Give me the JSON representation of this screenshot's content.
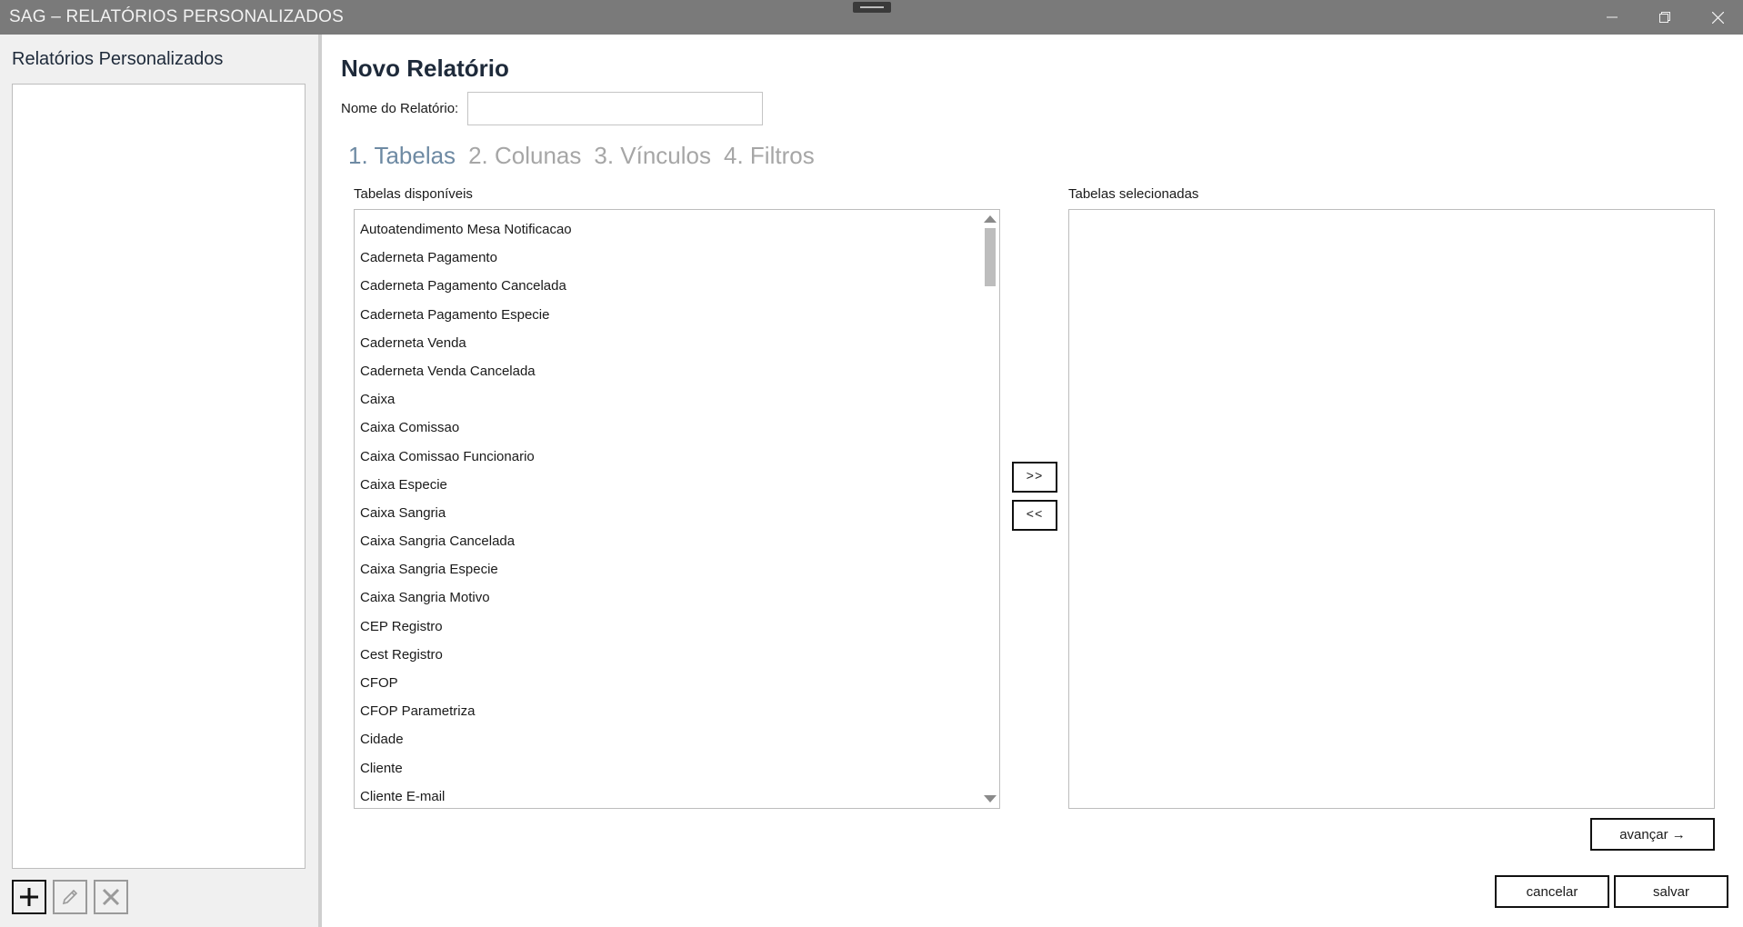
{
  "window": {
    "title": "SAG – RELATÓRIOS PERSONALIZADOS",
    "controls": [
      "minimize-icon",
      "restore-icon",
      "close-icon"
    ]
  },
  "sidebar": {
    "title": "Relatórios Personalizados",
    "items": [],
    "buttons": {
      "add": "plus-icon",
      "edit": "pencil-icon",
      "delete": "x-icon"
    }
  },
  "main": {
    "title": "Novo Relatório",
    "name_label": "Nome do Relatório:",
    "name_value": "",
    "steps": [
      {
        "label": "1. Tabelas",
        "active": true
      },
      {
        "label": "2. Colunas",
        "active": false
      },
      {
        "label": "3. Vínculos",
        "active": false
      },
      {
        "label": "4. Filtros",
        "active": false
      }
    ],
    "available": {
      "label": "Tabelas disponíveis",
      "items": [
        "Autoatendimento Mesa Notificacao",
        "Caderneta Pagamento",
        "Caderneta Pagamento Cancelada",
        "Caderneta Pagamento Especie",
        "Caderneta Venda",
        "Caderneta Venda Cancelada",
        "Caixa",
        "Caixa Comissao",
        "Caixa Comissao Funcionario",
        "Caixa Especie",
        "Caixa Sangria",
        "Caixa Sangria Cancelada",
        "Caixa Sangria Especie",
        "Caixa Sangria Motivo",
        "CEP Registro",
        "Cest Registro",
        "CFOP",
        "CFOP Parametriza",
        "Cidade",
        "Cliente",
        "Cliente E-mail"
      ]
    },
    "selected": {
      "label": "Tabelas selecionadas",
      "items": []
    },
    "move_add": ">>",
    "move_remove": "<<",
    "advance": "avançar →",
    "cancel": "cancelar",
    "save": "salvar"
  },
  "colors": {
    "titlebar": "#7a7a7a",
    "step_active": "#6e8aa3",
    "step_inactive": "#a6a6a6",
    "sidebar_bg": "#f0f0f0"
  }
}
